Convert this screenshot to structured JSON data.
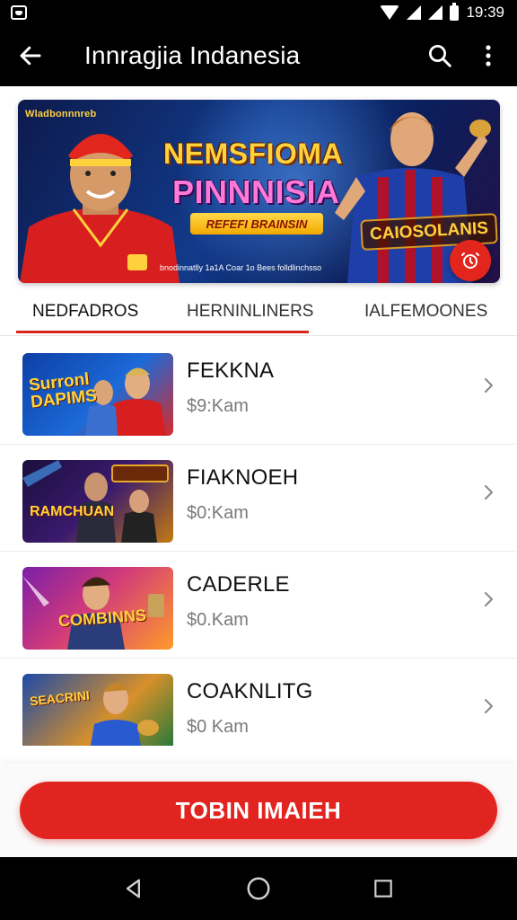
{
  "status_bar": {
    "time": "19:39"
  },
  "app_bar": {
    "title": "Innragjia  Indanesia",
    "icons": [
      "back-arrow-icon",
      "search-icon",
      "more-vert-icon"
    ]
  },
  "banner": {
    "small_text": "Wladbonnnreb",
    "headline_1": "NEMSFIOMA",
    "headline_2": "PINNNISIA",
    "pill_text": "REFEFI BRAINSIN",
    "brand_text": "CAIOSOLANIS",
    "caption": "bnodinnatlly 1a1A Coar 1o Bees folldlinchsso",
    "icon": "alarm-icon"
  },
  "tabs": [
    {
      "label": "NEDFADROS",
      "active": true
    },
    {
      "label": "HERNINLINERS",
      "active": false
    },
    {
      "label": "IALFEMOONES",
      "active": false
    }
  ],
  "items": [
    {
      "title": "FEKKNA",
      "subtitle": "$9:Kam",
      "thumb_text": "Surronl DAPIMS"
    },
    {
      "title": "FIAKNOEH",
      "subtitle": "$0:Kam",
      "thumb_text": "RAMCHUAN"
    },
    {
      "title": "CADERLE",
      "subtitle": "$0.Kam",
      "thumb_text": "COMBINNS"
    },
    {
      "title": "COAKNLITG",
      "subtitle": "$0 Kam",
      "thumb_text": "SEACRINI"
    }
  ],
  "cta": {
    "label": "TOBIN IMAIEH"
  },
  "colors": {
    "accent": "#e22420",
    "tab_indicator": "#d9261c",
    "bars": "#000000"
  }
}
